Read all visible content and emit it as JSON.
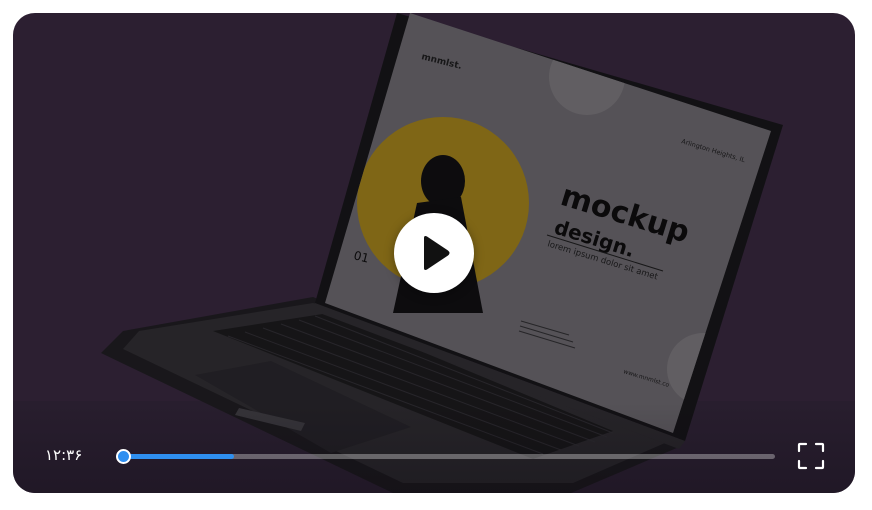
{
  "video": {
    "screen_brand": "mnmlst.",
    "screen_location": "Arlington Heights, IL",
    "screen_heading_line1": "mockup",
    "screen_heading_line2": "design.",
    "screen_tagline": "lorem ipsum dolor sit amet",
    "screen_number": "01",
    "screen_url": "www.mnmlst.co"
  },
  "controls": {
    "time": "۱۲:۳۶",
    "progress": 0.17,
    "icons": [
      "play-icon",
      "fullscreen-icon"
    ]
  },
  "colors": {
    "accent": "#2f8ff0",
    "background": "#302236",
    "screen_circle": "#e0a019"
  }
}
